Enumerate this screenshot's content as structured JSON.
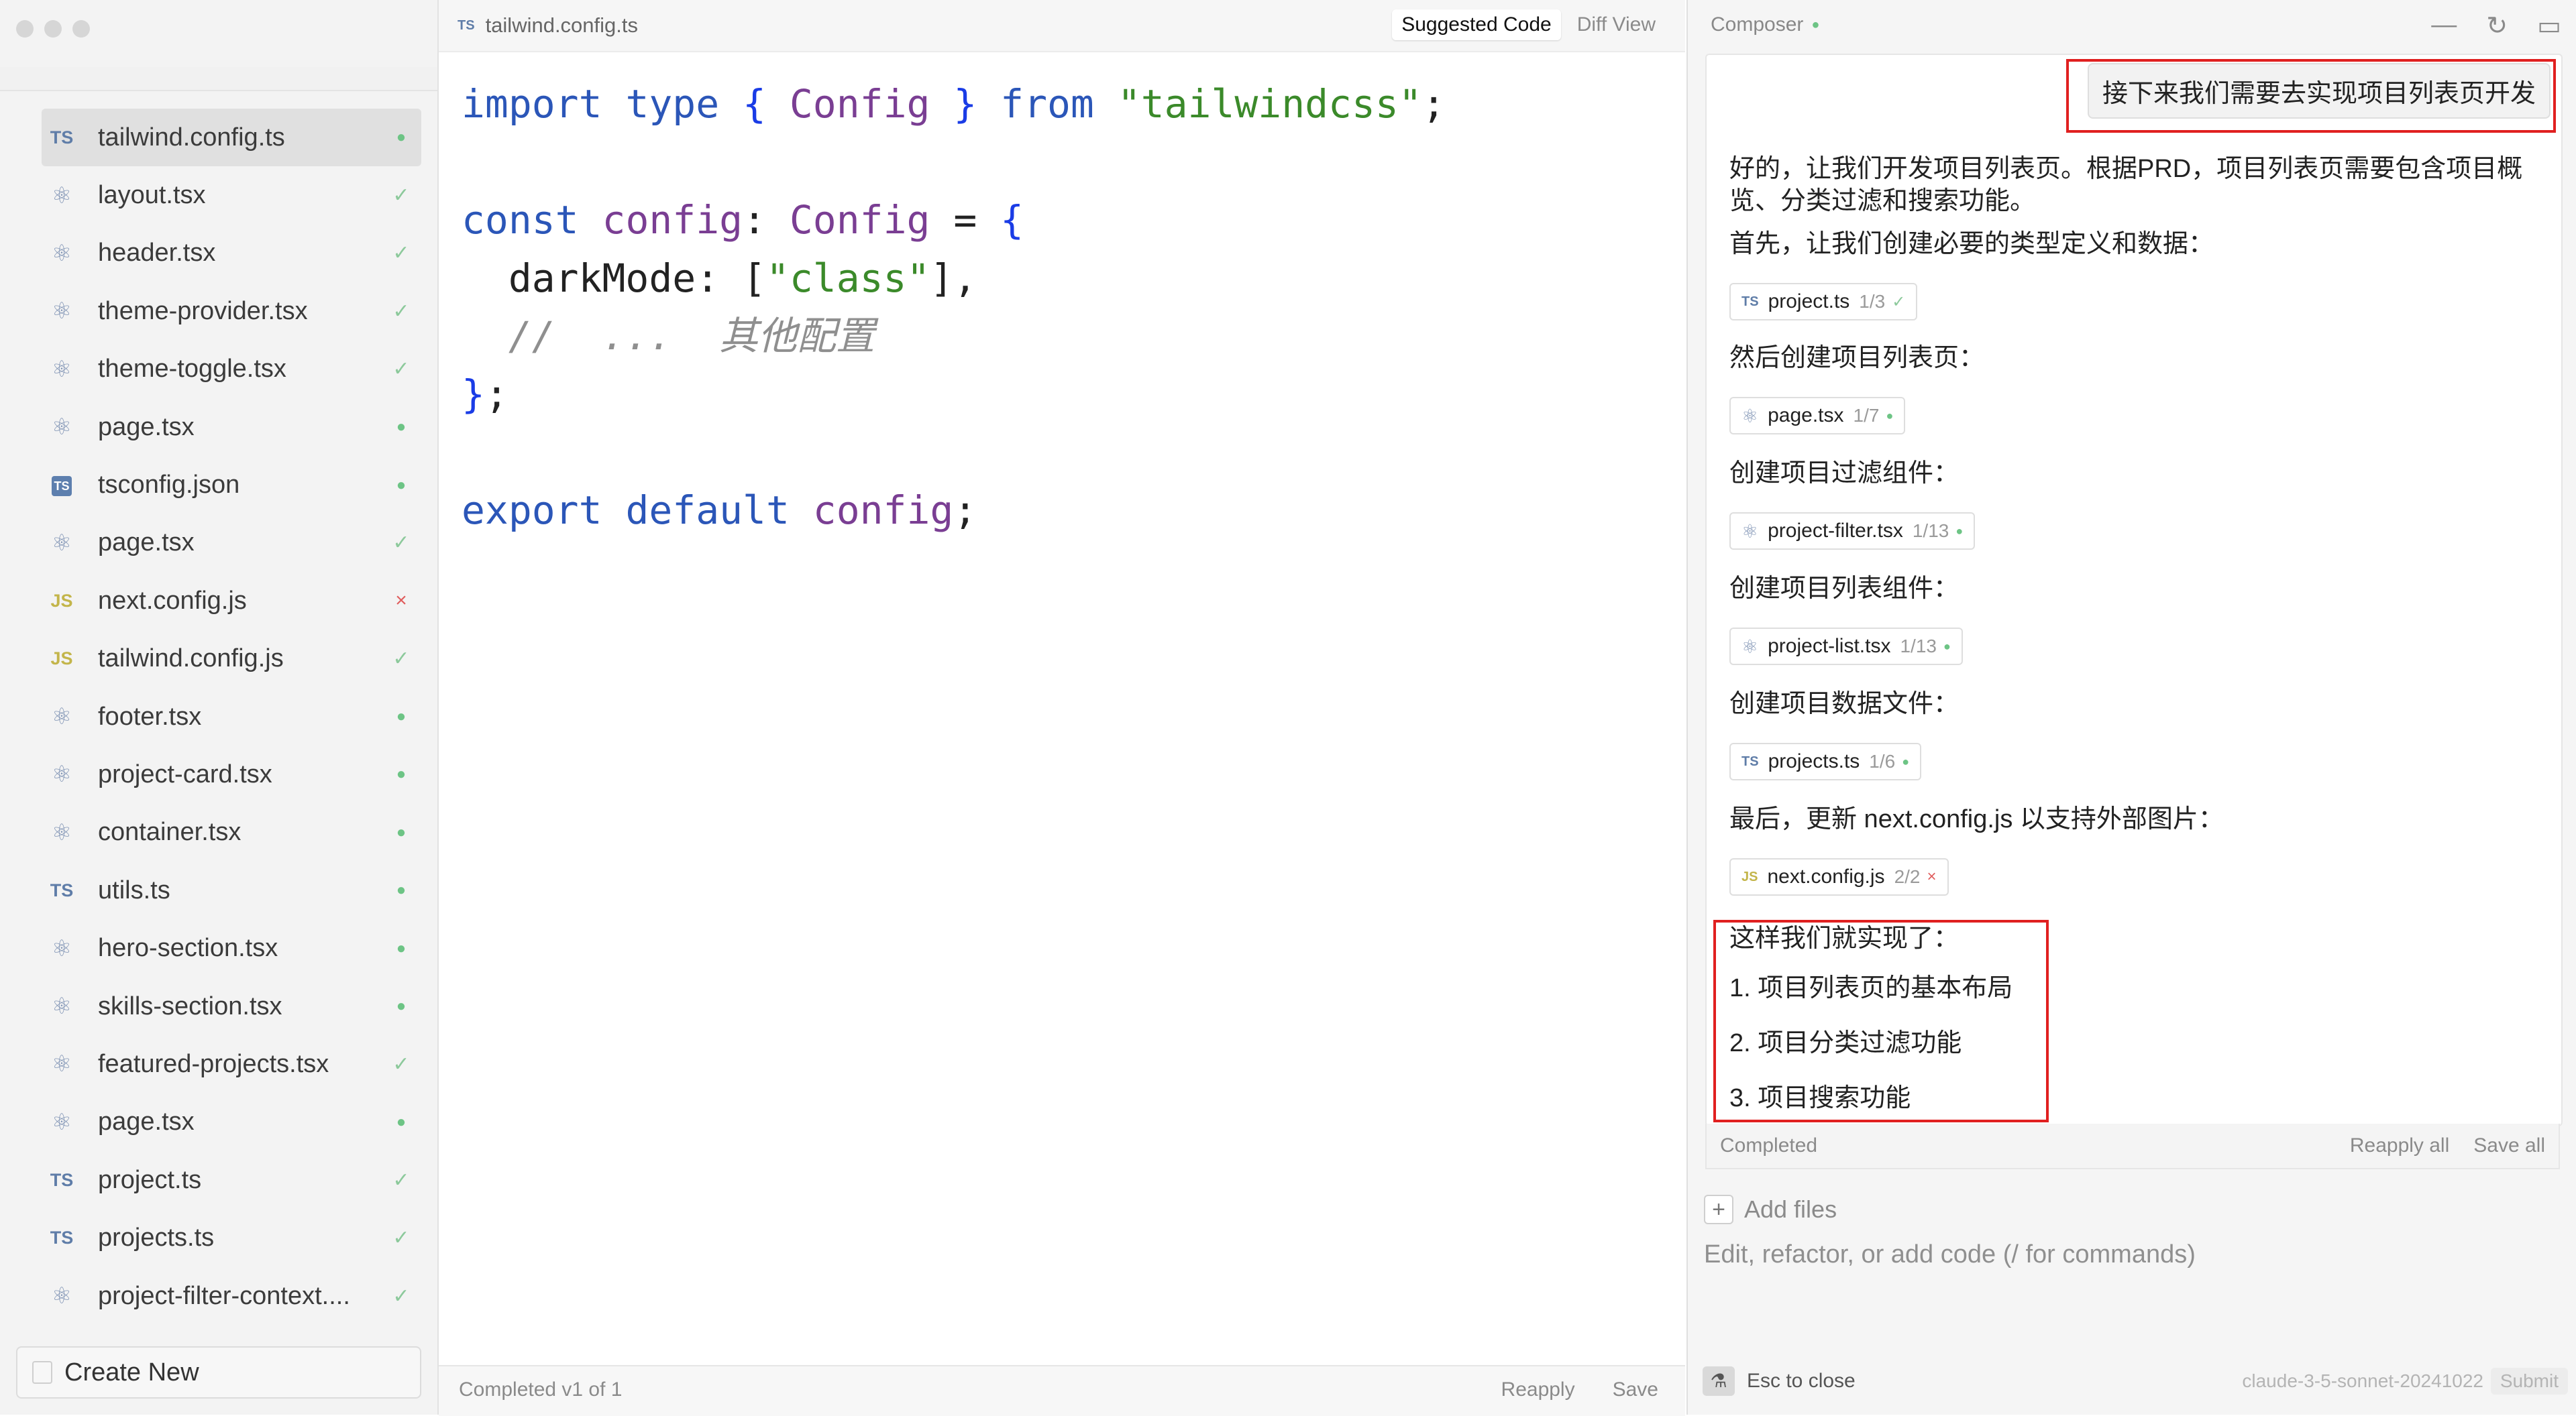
{
  "sidebar": {
    "files": [
      {
        "name": "tailwind.config.ts",
        "icon": "ts",
        "status": "dot",
        "active": true
      },
      {
        "name": "layout.tsx",
        "icon": "react",
        "status": "check"
      },
      {
        "name": "header.tsx",
        "icon": "react",
        "status": "check"
      },
      {
        "name": "theme-provider.tsx",
        "icon": "react",
        "status": "check"
      },
      {
        "name": "theme-toggle.tsx",
        "icon": "react",
        "status": "check"
      },
      {
        "name": "page.tsx",
        "icon": "react",
        "status": "dot"
      },
      {
        "name": "tsconfig.json",
        "icon": "json",
        "status": "dot"
      },
      {
        "name": "page.tsx",
        "icon": "react",
        "status": "check"
      },
      {
        "name": "next.config.js",
        "icon": "js",
        "status": "x"
      },
      {
        "name": "tailwind.config.js",
        "icon": "js",
        "status": "check"
      },
      {
        "name": "footer.tsx",
        "icon": "react",
        "status": "dot"
      },
      {
        "name": "project-card.tsx",
        "icon": "react",
        "status": "dot"
      },
      {
        "name": "container.tsx",
        "icon": "react",
        "status": "dot"
      },
      {
        "name": "utils.ts",
        "icon": "ts",
        "status": "dot"
      },
      {
        "name": "hero-section.tsx",
        "icon": "react",
        "status": "dot"
      },
      {
        "name": "skills-section.tsx",
        "icon": "react",
        "status": "dot"
      },
      {
        "name": "featured-projects.tsx",
        "icon": "react",
        "status": "check"
      },
      {
        "name": "page.tsx",
        "icon": "react",
        "status": "dot"
      },
      {
        "name": "project.ts",
        "icon": "ts",
        "status": "check"
      },
      {
        "name": "projects.ts",
        "icon": "ts",
        "status": "check"
      },
      {
        "name": "project-filter-context....",
        "icon": "react",
        "status": "check"
      }
    ],
    "create_new_label": "Create New"
  },
  "editor": {
    "tab_icon": "TS",
    "tab_name": "tailwind.config.ts",
    "suggested_code_label": "Suggested Code",
    "diff_view_label": "Diff View",
    "footer_status": "Completed  v1 of 1",
    "reapply_label": "Reapply",
    "save_label": "Save"
  },
  "composer": {
    "title": "Composer",
    "user_message": "接下来我们需要去实现项目列表页开发",
    "lines": [
      "好的，让我们开发项目列表页。根据PRD，项目列表页需要包含项目概",
      "览、分类过滤和搜索功能。",
      "首先，让我们创建必要的类型定义和数据：",
      "然后创建项目列表页：",
      "创建项目过滤组件：",
      "创建项目列表组件：",
      "创建项目数据文件：",
      "最后，更新 next.config.js 以支持外部图片："
    ],
    "chips": [
      {
        "icon": "TS",
        "name": "project.ts",
        "count": "1/3",
        "status": "check"
      },
      {
        "icon": "react",
        "name": "page.tsx",
        "count": "1/7",
        "status": "dot"
      },
      {
        "icon": "react",
        "name": "project-filter.tsx",
        "count": "1/13",
        "status": "dot"
      },
      {
        "icon": "react",
        "name": "project-list.tsx",
        "count": "1/13",
        "status": "dot"
      },
      {
        "icon": "TS",
        "name": "projects.ts",
        "count": "1/6",
        "status": "dot"
      },
      {
        "icon": "JS",
        "name": "next.config.js",
        "count": "2/2",
        "status": "x"
      }
    ],
    "summary": {
      "intro": "这样我们就实现了：",
      "items": [
        "1. 项目列表页的基本布局",
        "2. 项目分类过滤功能",
        "3. 项目搜索功能"
      ]
    },
    "status_text": "Completed",
    "reapply_all_label": "Reapply all",
    "save_all_label": "Save all",
    "add_files_label": "Add files",
    "prompt_placeholder": "Edit, refactor, or add code (/ for commands)",
    "esc_label": "Esc to close",
    "model_name": "claude-3-5-sonnet-20241022",
    "submit_label": "Submit"
  },
  "colors": {
    "accent_red": "#e02020",
    "status_green": "#6dc485",
    "error_red": "#e05d5d"
  }
}
